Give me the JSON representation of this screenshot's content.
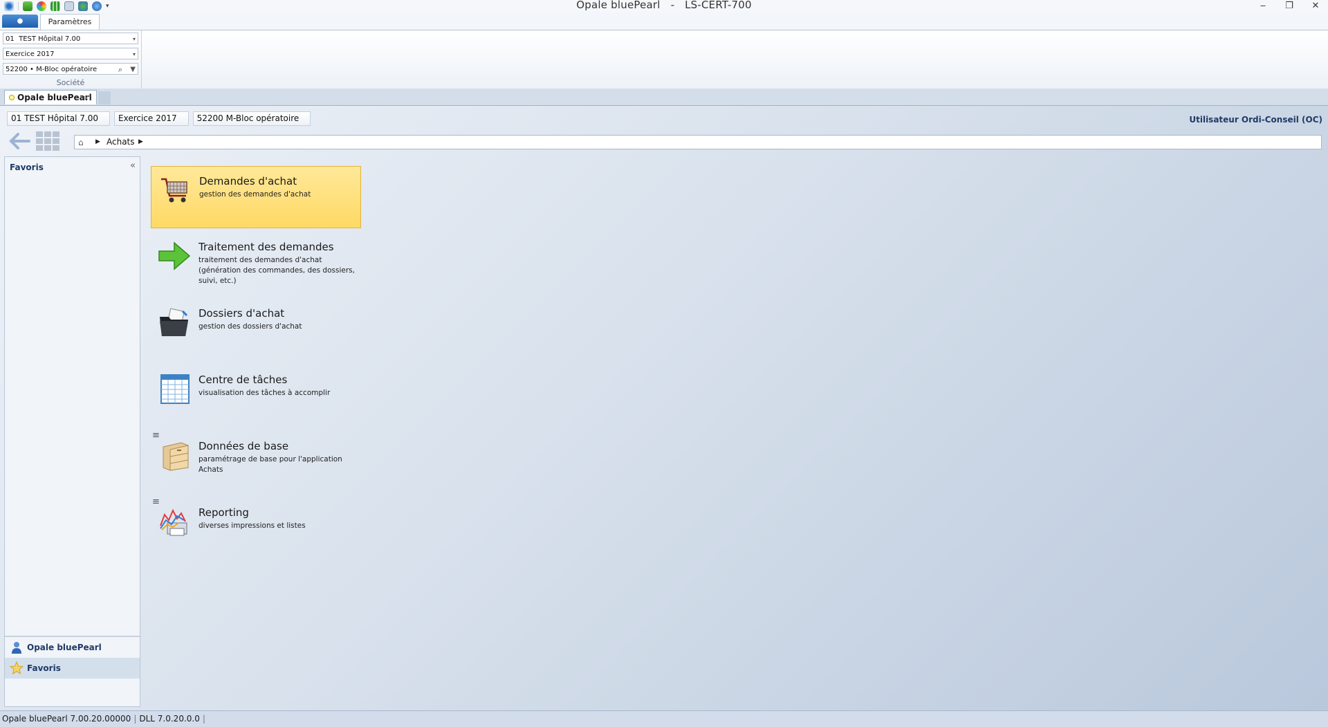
{
  "window": {
    "title": "Opale bluePearl   -   LS-CERT-700",
    "minimize_glyph": "‒",
    "restore_glyph": "❐",
    "close_glyph": "✕"
  },
  "quick_access": {
    "icons": [
      "eye-icon",
      "add-icon",
      "globe-color-icon",
      "grid-add-icon",
      "calculator-icon",
      "network-icon",
      "help-globe-icon"
    ],
    "dropdown_glyph": "▾"
  },
  "ribbon": {
    "tabs": [
      {
        "label": "Paramètres"
      }
    ],
    "societe_group": {
      "company_select": "01  TEST Hôpital 7.00",
      "exercise_select": "Exercice 2017",
      "service_select": "52200 • M-Bloc opératoire",
      "label": "Société"
    }
  },
  "doc_tab": {
    "label": "Opale bluePearl",
    "close_glyph": "×"
  },
  "context": {
    "company": "01 TEST Hôpital 7.00",
    "exercise": "Exercice 2017",
    "service": "52200 M-Bloc opératoire",
    "user": "Utilisateur Ordi-Conseil (OC)"
  },
  "breadcrumb": {
    "items": [
      "Achats"
    ],
    "arrow": "▶"
  },
  "sidebar": {
    "title": "Favoris",
    "collapse_glyph": "«",
    "nav": [
      {
        "label": "Opale bluePearl",
        "icon": "user-icon"
      },
      {
        "label": "Favoris",
        "icon": "star-icon",
        "active": true
      }
    ]
  },
  "tiles": [
    {
      "title": "Demandes d'achat",
      "desc": "gestion des demandes d'achat",
      "icon": "shopping-cart-icon",
      "selected": true
    },
    {
      "title": "Traitement des demandes",
      "desc": "traitement des demandes d'achat (génération des commandes, des dossiers, suivi, etc.)",
      "icon": "green-arrow-icon"
    },
    {
      "title": "Dossiers d'achat",
      "desc": "gestion des dossiers d'achat",
      "icon": "folder-icon"
    },
    {
      "title": "Centre de tâches",
      "desc": "visualisation des tâches à accomplir",
      "icon": "task-table-icon"
    },
    {
      "title": "Données de base",
      "desc": "paramétrage de base pour l'application Achats",
      "icon": "cabinet-icon",
      "menu": true
    },
    {
      "title": "Reporting",
      "desc": "diverses impressions et listes",
      "icon": "report-icon",
      "menu": true
    }
  ],
  "tile_menu_glyph": "≡",
  "status": {
    "version": "Opale bluePearl 7.00.20.00000",
    "dll": "DLL 7.0.20.0.0",
    "separator": "|"
  },
  "colors": {
    "tile_selected": "#ffd964",
    "accent_blue": "#1f3a66",
    "ribbon_app_tab": "#1f5fae"
  }
}
